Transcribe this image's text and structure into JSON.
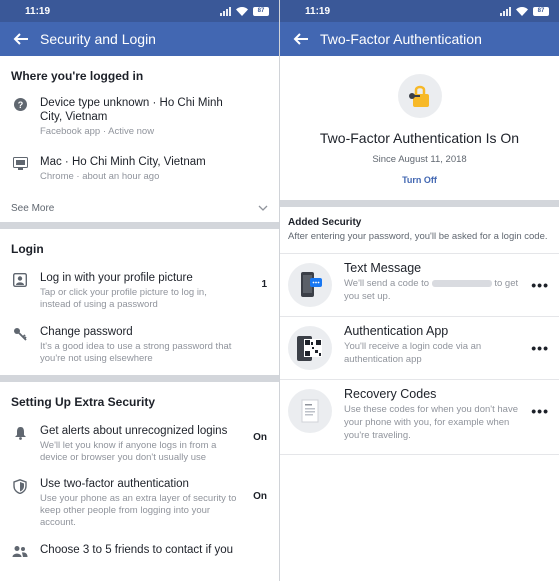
{
  "left": {
    "status": {
      "time": "11:19",
      "battery": "87"
    },
    "appbar": {
      "title": "Security and Login"
    },
    "logged_in": {
      "title": "Where you're logged in",
      "items": [
        {
          "device": "Device type unknown · Ho Chi Minh City, Vietnam",
          "detail": "Facebook app · Active now"
        },
        {
          "device": "Mac · Ho Chi Minh City, Vietnam",
          "detail": "Chrome · about an hour ago"
        }
      ],
      "see_more": "See More"
    },
    "login": {
      "title": "Login",
      "items": [
        {
          "main": "Log in with your profile picture",
          "sub": "Tap or click your profile picture to log in, instead of using a password",
          "state": "1"
        },
        {
          "main": "Change password",
          "sub": "It's a good idea to use a strong password that you're not using elsewhere",
          "state": ""
        }
      ]
    },
    "extra": {
      "title": "Setting Up Extra Security",
      "items": [
        {
          "main": "Get alerts about unrecognized logins",
          "sub": "We'll let you know if anyone logs in from a device or browser you don't usually use",
          "state": "On"
        },
        {
          "main": "Use two-factor authentication",
          "sub": "Use your phone as an extra layer of security to keep other people from logging into your account.",
          "state": "On"
        },
        {
          "main": "Choose 3 to 5 friends to contact if you",
          "sub": "",
          "state": ""
        }
      ]
    }
  },
  "right": {
    "status": {
      "time": "11:19",
      "battery": "87"
    },
    "appbar": {
      "title": "Two-Factor Authentication"
    },
    "header": {
      "title": "Two-Factor Authentication Is On",
      "since": "Since August 11, 2018",
      "turn_off": "Turn Off"
    },
    "added": {
      "title": "Added Security",
      "desc": "After entering your password, you'll be asked for a login code."
    },
    "methods": [
      {
        "name": "Text Message",
        "desc_a": "We'll send a code to",
        "desc_b": "to get you set up.",
        "icon": "phone-sms-icon"
      },
      {
        "name": "Authentication App",
        "desc": "You'll receive a login code via an authentication app",
        "icon": "qr-code-icon"
      },
      {
        "name": "Recovery Codes",
        "desc": "Use these codes for when you don't have your phone with you, for example when you're traveling.",
        "icon": "document-icon"
      }
    ],
    "more": "•••"
  }
}
